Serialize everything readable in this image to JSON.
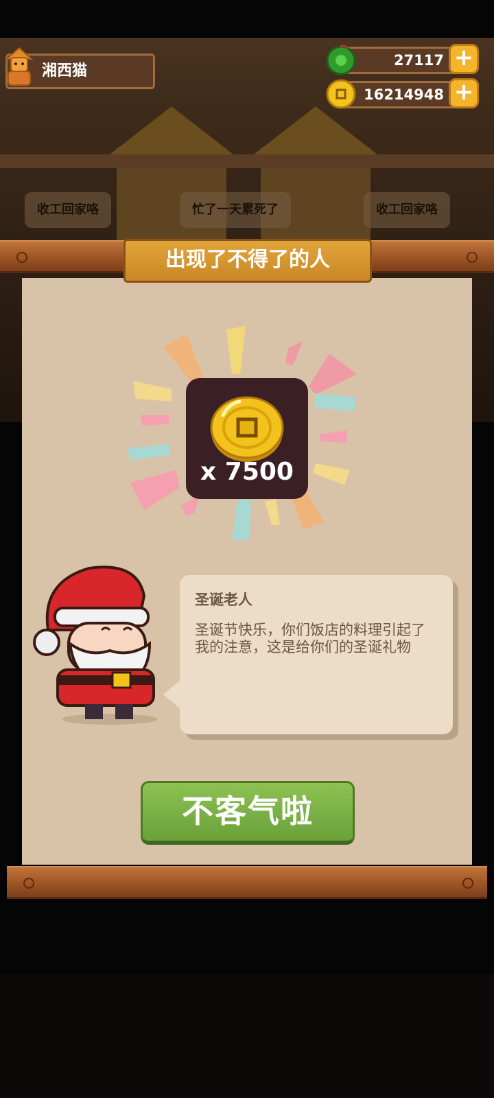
{
  "player": {
    "name": "湘西猫"
  },
  "resources": {
    "gems": {
      "value": "27117",
      "icon": "green-gem-icon",
      "color": "#3da52f"
    },
    "coins": {
      "value": "16214948",
      "icon": "gold-coin-icon",
      "color": "#f2c21b"
    }
  },
  "background": {
    "bubbles": [
      "收工回家咯",
      "忙了一天累死了",
      "收工回家咯"
    ]
  },
  "dialog": {
    "title": "出现了不得了的人",
    "reward": {
      "icon": "gold-coin-icon",
      "count_label": "x 7500"
    },
    "speaker": "圣诞老人",
    "message": "圣诞节快乐，你们饭店的料理引起了我的注意，这是给你们的圣诞礼物",
    "confirm_label": "不客气啦"
  },
  "colors": {
    "scroll_paper": "#d9c3a8",
    "title_gold": "#e2a53a",
    "button_green": "#7bb447",
    "reward_box": "#3a1f24"
  }
}
